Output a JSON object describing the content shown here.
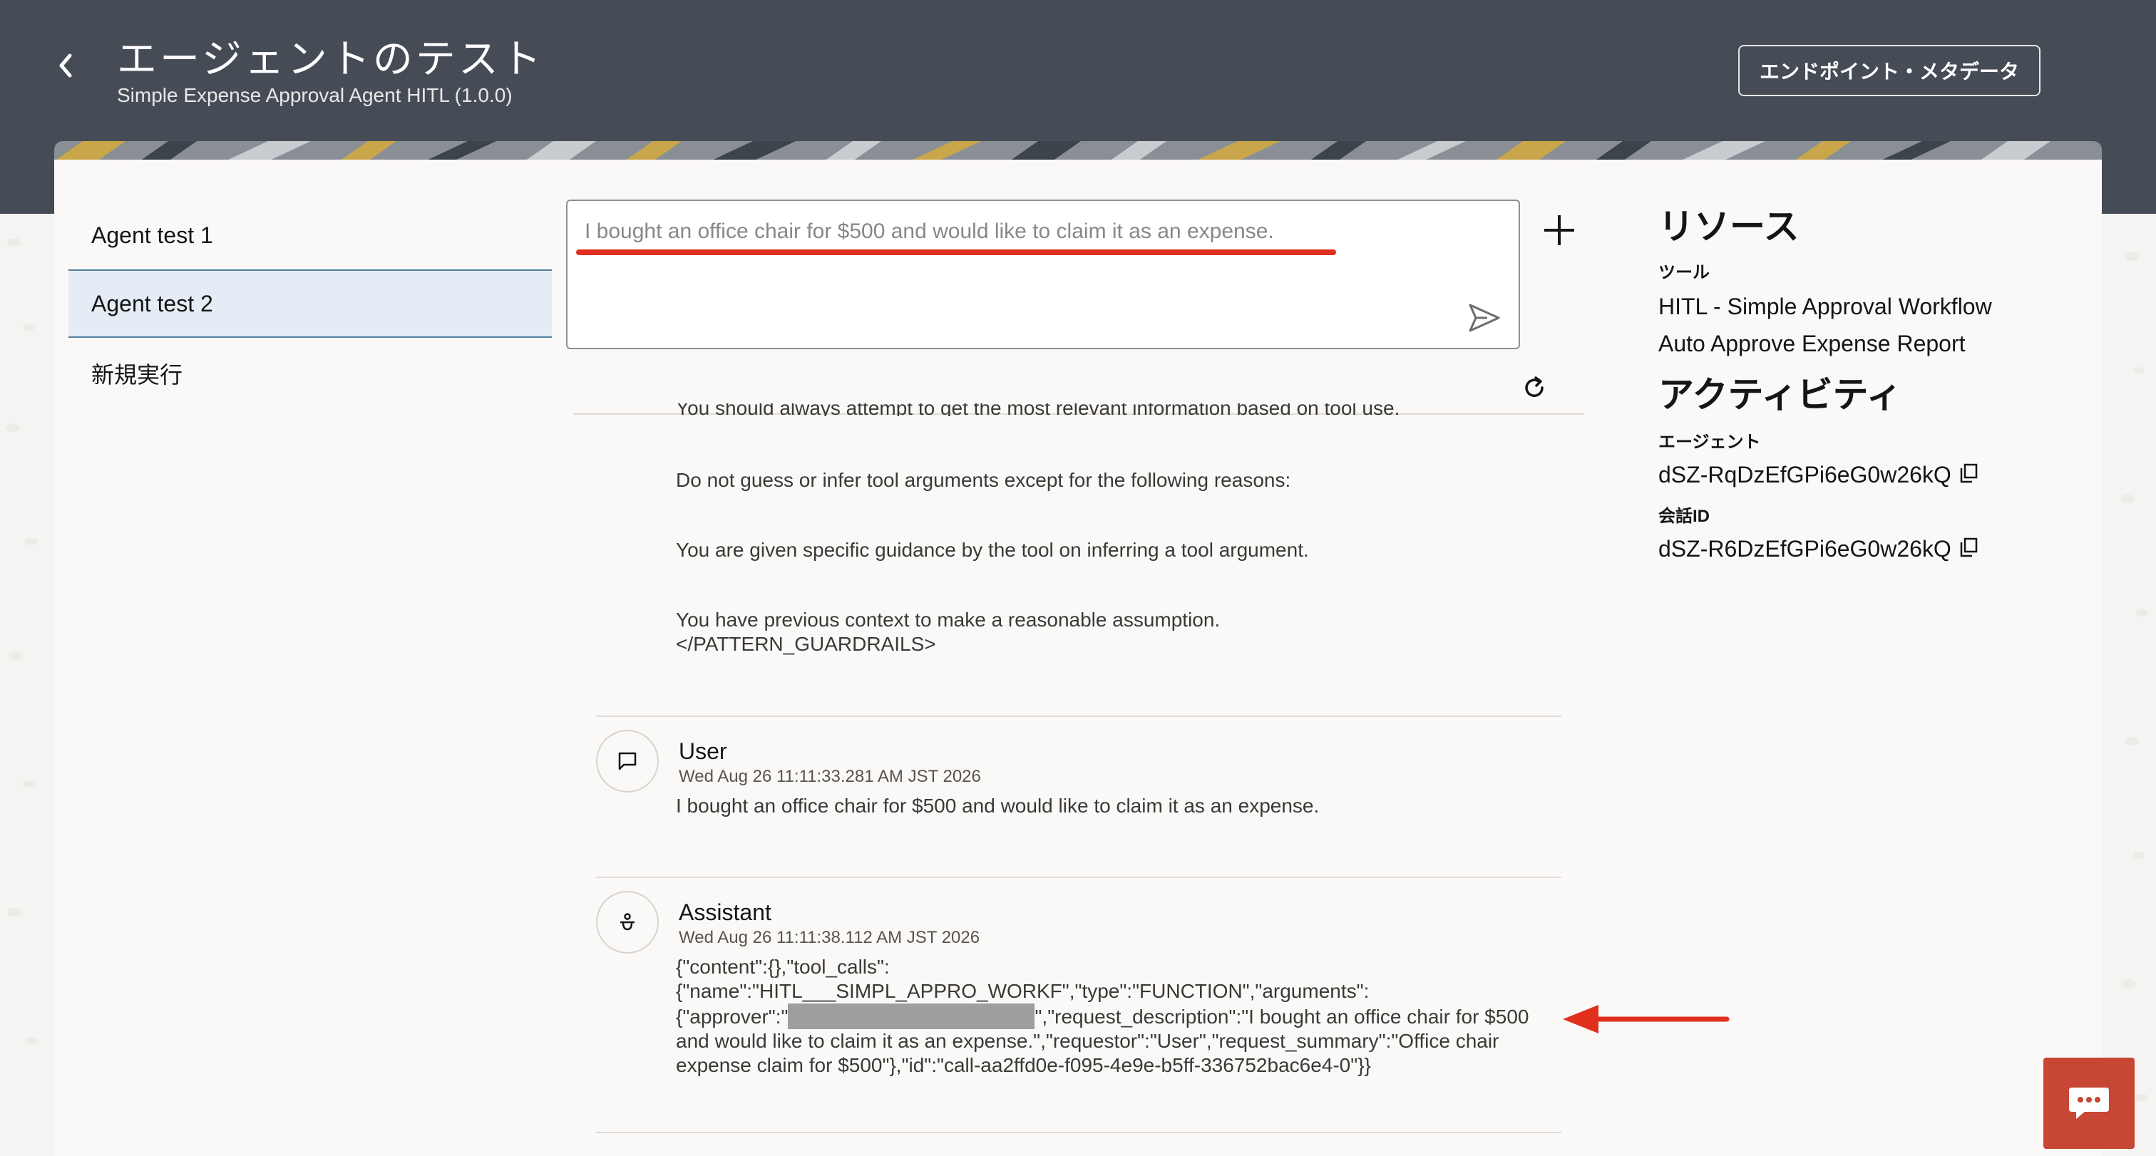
{
  "header": {
    "title": "エージェントのテスト",
    "subtitle": "Simple Expense Approval Agent HITL (1.0.0)",
    "endpoint_button": "エンドポイント・メタデータ"
  },
  "sidebar": {
    "items": [
      {
        "label": "Agent test 1"
      },
      {
        "label": "Agent test 2"
      },
      {
        "label": "新規実行"
      }
    ]
  },
  "input": {
    "value": "I bought an office chair for $500 and would like to claim it as an expense."
  },
  "chat": {
    "prompt_cut_line": "You should always attempt to get the most relevant information based on tool use.",
    "prompt_lines": [
      "Do not guess or infer tool arguments except for the following reasons:",
      "You are given specific guidance by the tool on inferring a tool argument.",
      "You have previous context to make a reasonable assumption.",
      "</PATTERN_GUARDRAILS>"
    ],
    "messages": [
      {
        "role": "User",
        "timestamp": "Wed Aug 26 11:11:33.281 AM JST 2026",
        "body": "I bought an office chair for $500 and would like to claim it as an expense."
      },
      {
        "role": "Assistant",
        "timestamp": "Wed Aug 26 11:11:38.112 AM JST 2026",
        "lines": [
          "{\"content\":{},\"tool_calls\":",
          "{\"name\":\"HITL___SIMPL_APPRO_WORKF\",\"type\":\"FUNCTION\",\"arguments\":",
          "{\"approver\":\"",
          "\",\"request_description\":\"I bought an office chair for $500",
          "and would like to claim it as an expense.\",\"requestor\":\"User\",\"request_summary\":\"Office chair",
          "expense claim for $500\"},\"id\":\"call-aa2ffd0e-f095-4e9e-b5ff-336752bac6e4-0\"}}"
        ]
      }
    ]
  },
  "resources": {
    "heading": "リソース",
    "tools_label": "ツール",
    "tools": [
      "HITL - Simple Approval Workflow",
      "Auto Approve Expense Report"
    ],
    "activity_heading": "アクティビティ",
    "agent_label": "エージェント",
    "agent_id": "dSZ-RqDzEfGPi6eG0w26kQ",
    "conversation_label": "会話ID",
    "conversation_id": "dSZ-R6DzEfGPi6eG0w26kQ"
  },
  "colors": {
    "header_bg": "#464c55",
    "accent_red": "#e02f1d",
    "chat_widget": "#c74634",
    "selected_bg": "#e4edf5"
  },
  "icons": [
    "back-chevron-icon",
    "send-icon",
    "plus-icon",
    "refresh-icon",
    "chat-bubble-icon",
    "assistant-icon",
    "copy-icon",
    "chat-widget-icon"
  ]
}
